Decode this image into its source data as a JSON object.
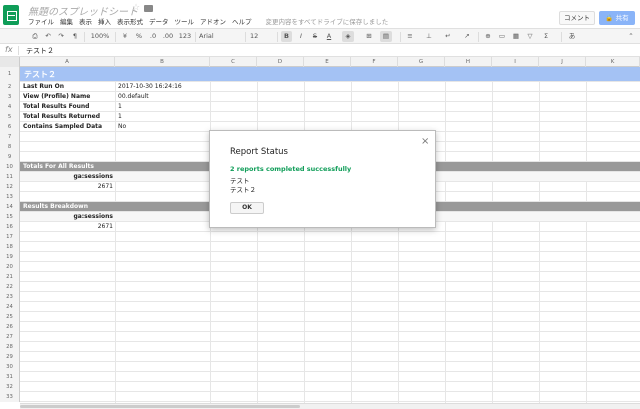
{
  "app": {
    "doc_title": "無題のスプレッドシート",
    "menu": [
      "ファイル",
      "編集",
      "表示",
      "挿入",
      "表示形式",
      "データ",
      "ツール",
      "アドオン",
      "ヘルプ"
    ],
    "save_status": "変更内容をすべてドライブに保存しました",
    "comment_label": "コメント",
    "share_label": "共有",
    "brand_color": "#0f9d58"
  },
  "toolbar": {
    "zoom": "100%",
    "currency": "¥",
    "percent": "%",
    "decimal_less": ".0",
    "decimal_more": ".00",
    "format_more": "123",
    "font": "Arial",
    "font_size": "12",
    "bold": "B",
    "italic": "I",
    "strike": "S",
    "text_color": "A",
    "fill_color": "◈",
    "sigma": "Σ",
    "input_tools": "あ"
  },
  "formula_bar": {
    "fx_label": "fx",
    "value": "テスト２"
  },
  "columns": [
    "A",
    "B",
    "C",
    "D",
    "E",
    "F",
    "G",
    "H",
    "I",
    "J",
    "K"
  ],
  "sheet": {
    "title": "テスト２",
    "meta_rows": [
      {
        "label": "Last Run On",
        "value": "2017-10-30 16:24:16"
      },
      {
        "label": "View (Profile) Name",
        "value": "00.default"
      },
      {
        "label": "Total Results Found",
        "value": "1"
      },
      {
        "label": "Total Results Returned",
        "value": "1"
      },
      {
        "label": "Contains Sampled Data",
        "value": "No"
      }
    ],
    "totals_header": "Totals For All Results",
    "totals_metric": "ga:sessions",
    "totals_value": "2671",
    "breakdown_header": "Results Breakdown",
    "breakdown_metric": "ga:sessions",
    "breakdown_value": "2671"
  },
  "dialog": {
    "title": "Report Status",
    "status": "2 reports completed successfully",
    "lines": [
      "テスト",
      "テスト２"
    ],
    "ok_label": "OK",
    "status_color": "#0f9d58"
  }
}
